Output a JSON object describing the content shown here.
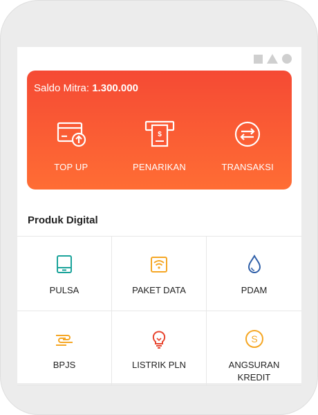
{
  "card": {
    "balance_label": "Saldo Mitra:",
    "balance_value": "1.300.000",
    "actions": [
      {
        "label": "TOP UP",
        "icon": "wallet-topup-icon"
      },
      {
        "label": "PENARIKAN",
        "icon": "atm-withdraw-icon"
      },
      {
        "label": "TRANSAKSI",
        "icon": "transfer-arrows-icon"
      }
    ]
  },
  "section": {
    "title": "Produk Digital"
  },
  "products": [
    {
      "label": "PULSA",
      "icon": "phone-icon",
      "color": "#1aa39a"
    },
    {
      "label": "PAKET DATA",
      "icon": "wifi-icon",
      "color": "#f5a623"
    },
    {
      "label": "PDAM",
      "icon": "water-drop-icon",
      "color": "#2f5fa8"
    },
    {
      "label": "BPJS",
      "icon": "hands-icon",
      "color": "#f5a623"
    },
    {
      "label": "LISTRIK PLN",
      "icon": "lightbulb-icon",
      "color": "#e8452f"
    },
    {
      "label": "ANGSURAN KREDIT",
      "icon": "coin-icon",
      "color": "#f5a623"
    }
  ],
  "colors": {
    "card_top": "#f54a34",
    "card_bottom": "#ff6d34"
  }
}
